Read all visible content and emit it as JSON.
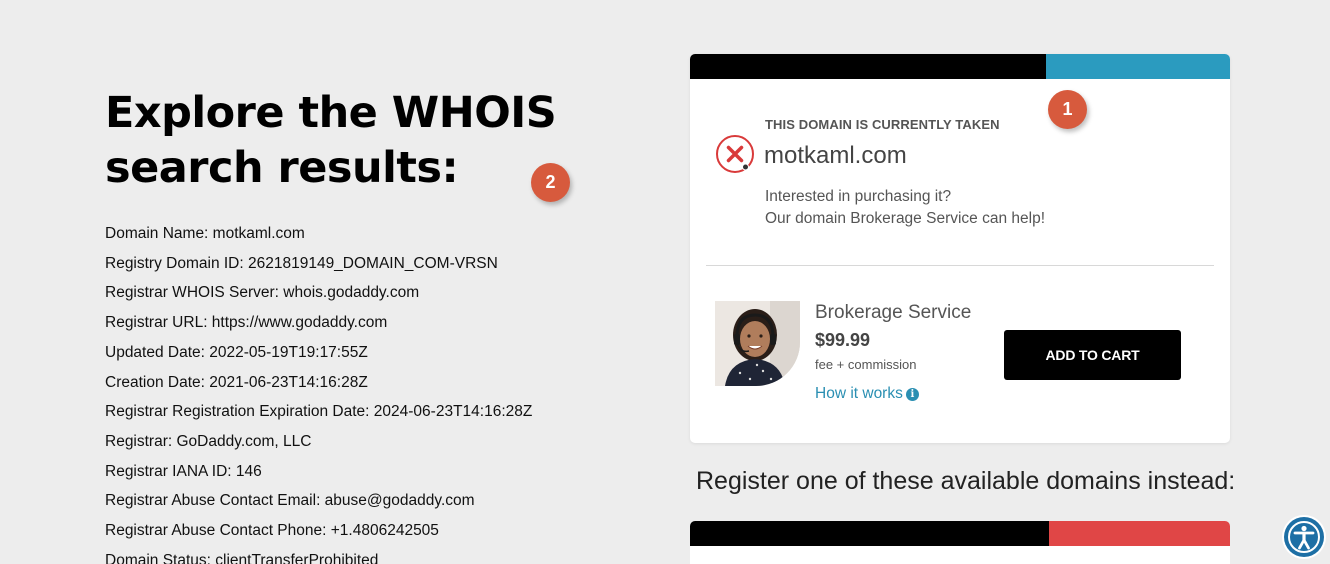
{
  "page": {
    "title_line1": "Explore the WHOIS",
    "title_line2": "search results:"
  },
  "whois": [
    "Domain Name: motkaml.com",
    "Registry Domain ID: 2621819149_DOMAIN_COM-VRSN",
    "Registrar WHOIS Server: whois.godaddy.com",
    "Registrar URL: https://www.godaddy.com",
    "Updated Date: 2022-05-19T19:17:55Z",
    "Creation Date: 2021-06-23T14:16:28Z",
    "Registrar Registration Expiration Date: 2024-06-23T14:16:28Z",
    "Registrar: GoDaddy.com, LLC",
    "Registrar IANA ID: 146",
    "Registrar Abuse Contact Email: abuse@godaddy.com",
    "Registrar Abuse Contact Phone: +1.4806242505",
    "Domain Status: clientTransferProhibited"
  ],
  "badges": {
    "one": "1",
    "two": "2"
  },
  "card": {
    "status_label": "THIS DOMAIN IS CURRENTLY TAKEN",
    "domain": "motkaml.com",
    "pitch_line1": "Interested in purchasing it?",
    "pitch_line2": "Our domain Brokerage Service can help!",
    "service_name": "Brokerage Service",
    "price": "$99.99",
    "fee_note": "fee + commission",
    "how_link": "How it works",
    "add_to_cart": "ADD TO CART"
  },
  "register_heading": "Register one of these available domains instead:",
  "colors": {
    "accent_teal": "#2b9bbf",
    "accent_red": "#e04646",
    "badge": "#d75a3d",
    "link": "#2a8fb2",
    "taken_icon": "#d93a3a"
  },
  "icons": {
    "taken": "x-circle-icon",
    "info": "info-circle-icon",
    "accessibility": "accessibility-icon"
  }
}
